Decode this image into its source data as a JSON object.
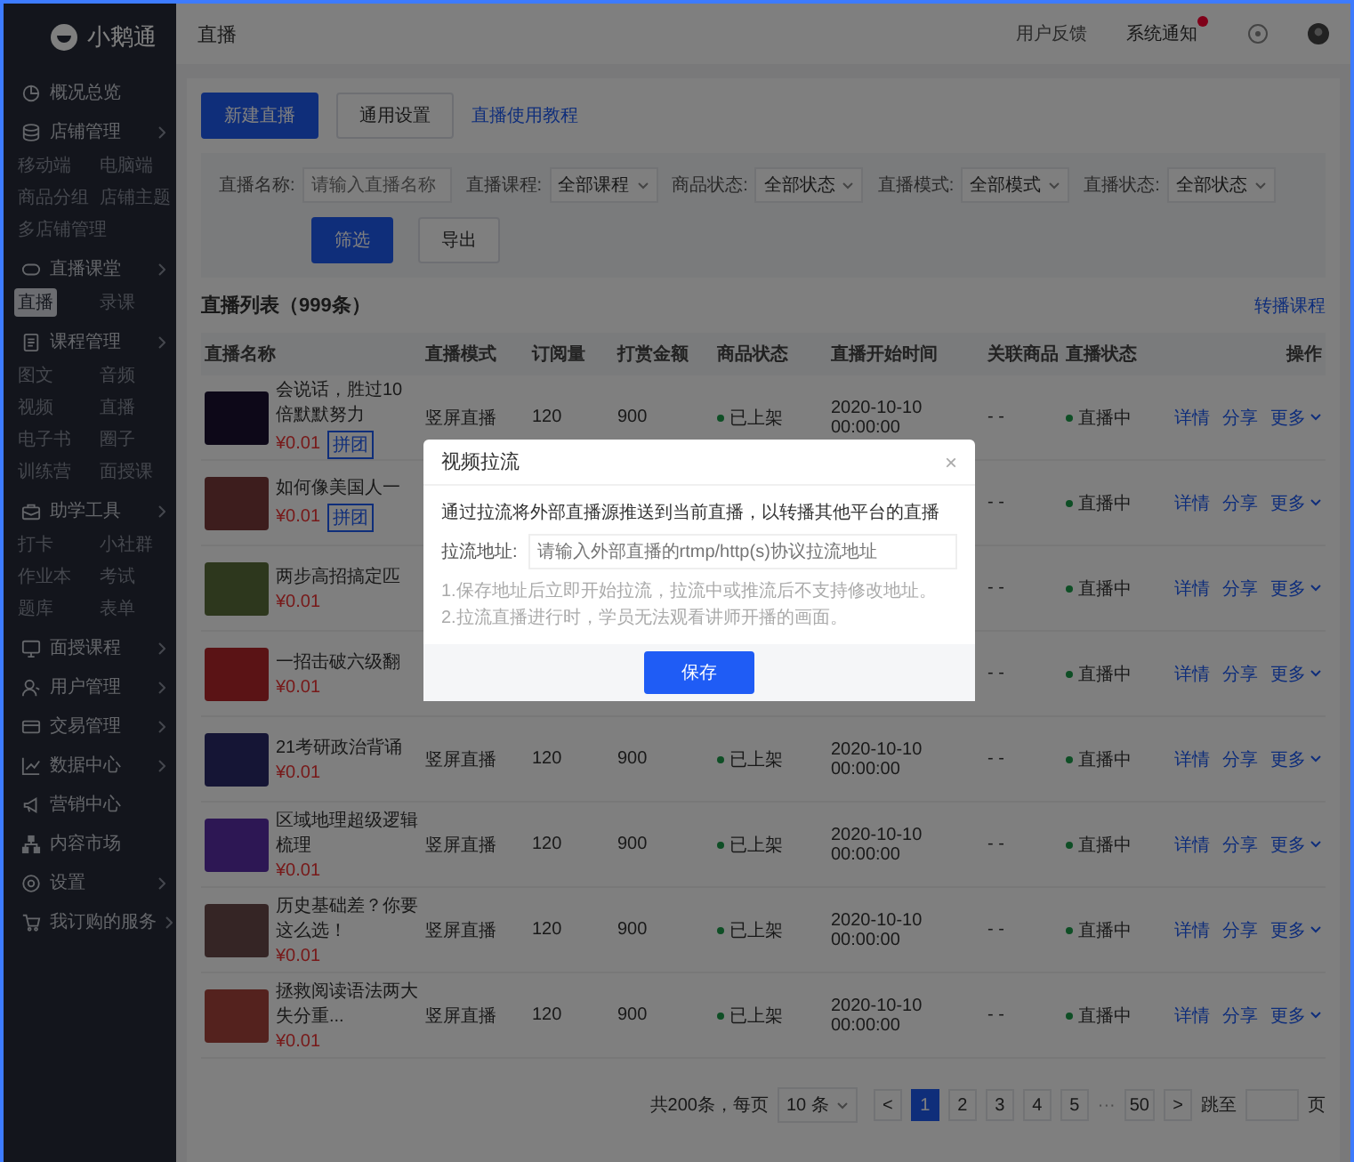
{
  "brand": {
    "name": "小鹅通"
  },
  "sidebar": {
    "items": [
      {
        "label": "概况总览",
        "chevron": false
      },
      {
        "label": "店铺管理",
        "chevron": true,
        "children": [
          {
            "label": "移动端",
            "selected": false
          },
          {
            "label": "电脑端",
            "selected": false
          },
          {
            "label": "商品分组",
            "selected": false
          },
          {
            "label": "店铺主题",
            "selected": false
          },
          {
            "label": "多店铺管理",
            "selected": false
          }
        ]
      },
      {
        "label": "直播课堂",
        "chevron": true,
        "children": [
          {
            "label": "直播",
            "selected": true
          },
          {
            "label": "录课",
            "selected": false
          }
        ]
      },
      {
        "label": "课程管理",
        "chevron": true,
        "children": [
          {
            "label": "图文",
            "selected": false
          },
          {
            "label": "音频",
            "selected": false
          },
          {
            "label": "视频",
            "selected": false
          },
          {
            "label": "直播",
            "selected": false
          },
          {
            "label": "电子书",
            "selected": false
          },
          {
            "label": "圈子",
            "selected": false
          },
          {
            "label": "训练营",
            "selected": false
          },
          {
            "label": "面授课",
            "selected": false
          }
        ]
      },
      {
        "label": "助学工具",
        "chevron": true,
        "children": [
          {
            "label": "打卡",
            "selected": false
          },
          {
            "label": "小社群",
            "selected": false
          },
          {
            "label": "作业本",
            "selected": false
          },
          {
            "label": "考试",
            "selected": false
          },
          {
            "label": "题库",
            "selected": false
          },
          {
            "label": "表单",
            "selected": false
          }
        ]
      },
      {
        "label": "面授课程",
        "chevron": true
      },
      {
        "label": "用户管理",
        "chevron": true
      },
      {
        "label": "交易管理",
        "chevron": true
      },
      {
        "label": "数据中心",
        "chevron": true
      },
      {
        "label": "营销中心",
        "chevron": false
      },
      {
        "label": "内容市场",
        "chevron": false
      },
      {
        "label": "设置",
        "chevron": true
      },
      {
        "label": "我订购的服务",
        "chevron": true
      }
    ]
  },
  "topbar": {
    "title": "直播",
    "feedback": "用户反馈",
    "notifications": {
      "label": "系统通知",
      "unread": true
    }
  },
  "toolbar": {
    "primary": "新建直播",
    "secondary": "通用设置",
    "link": "直播使用教程"
  },
  "filters": {
    "name": {
      "label": "直播名称:",
      "placeholder": "请输入直播名称"
    },
    "selects": [
      {
        "label": "直播课程:",
        "value": "全部课程"
      },
      {
        "label": "商品状态:",
        "value": "全部状态"
      },
      {
        "label": "直播模式:",
        "value": "全部模式"
      },
      {
        "label": "直播状态:",
        "value": "全部状态"
      }
    ],
    "apply": "筛选",
    "export": "导出"
  },
  "list": {
    "title": "直播列表（999条）",
    "link": "转播课程"
  },
  "table": {
    "columns": [
      "直播名称",
      "直播模式",
      "订阅量",
      "打赏金额",
      "商品状态",
      "直播开始时间",
      "关联商品",
      "直播状态",
      "操作"
    ],
    "rows": [
      {
        "title": "会说话，胜过10倍默默努力",
        "price": "¥0.01",
        "tag": "拼团",
        "mode": "竖屏直播",
        "subs": "120",
        "amount": "900",
        "product_status": "已上架",
        "start_time": [
          "2020-10-10",
          "00:00:00"
        ],
        "related": "- -",
        "live_status": "直播中",
        "actions": [
          "详情",
          "分享",
          "更多"
        ]
      },
      {
        "title": "如何像美国人一",
        "price": "¥0.01",
        "tag": "拼团",
        "related": "- -",
        "live_status": "直播中",
        "actions": [
          "详情",
          "分享",
          "更多"
        ]
      },
      {
        "title": "两步高招搞定匹",
        "price": "¥0.01",
        "related": "- -",
        "live_status": "直播中",
        "actions": [
          "详情",
          "分享",
          "更多"
        ]
      },
      {
        "title": "一招击破六级翻",
        "price": "¥0.01",
        "related": "- -",
        "live_status": "直播中",
        "actions": [
          "详情",
          "分享",
          "更多"
        ]
      },
      {
        "title": "21考研政治背诵",
        "price": "¥0.01",
        "mode": "竖屏直播",
        "subs": "120",
        "amount": "900",
        "product_status": "已上架",
        "start_time": [
          "2020-10-10",
          "00:00:00"
        ],
        "related": "- -",
        "live_status": "直播中",
        "actions": [
          "详情",
          "分享",
          "更多"
        ]
      },
      {
        "title": "区域地理超级逻辑梳理",
        "price": "¥0.01",
        "mode": "竖屏直播",
        "subs": "120",
        "amount": "900",
        "product_status": "已上架",
        "start_time": [
          "2020-10-10",
          "00:00:00"
        ],
        "related": "- -",
        "live_status": "直播中",
        "actions": [
          "详情",
          "分享",
          "更多"
        ]
      },
      {
        "title": "历史基础差？你要这么选！",
        "price": "¥0.01",
        "mode": "竖屏直播",
        "subs": "120",
        "amount": "900",
        "product_status": "已上架",
        "start_time": [
          "2020-10-10",
          "00:00:00"
        ],
        "related": "- -",
        "live_status": "直播中",
        "actions": [
          "详情",
          "分享",
          "更多"
        ]
      },
      {
        "title": "拯救阅读语法两大失分重...",
        "price": "¥0.01",
        "mode": "竖屏直播",
        "subs": "120",
        "amount": "900",
        "product_status": "已上架",
        "start_time": [
          "2020-10-10",
          "00:00:00"
        ],
        "related": "- -",
        "live_status": "直播中",
        "actions": [
          "详情",
          "分享",
          "更多"
        ]
      }
    ]
  },
  "pagination": {
    "total": "共200条，每页",
    "page_size": "10 条",
    "pages": [
      {
        "kind": "page",
        "label": "1",
        "selected": true
      },
      {
        "kind": "page",
        "label": "2",
        "selected": false
      },
      {
        "kind": "page",
        "label": "3",
        "selected": false
      },
      {
        "kind": "page",
        "label": "4",
        "selected": false
      },
      {
        "kind": "page",
        "label": "5",
        "selected": false
      },
      {
        "kind": "ellipsis",
        "label": "···"
      },
      {
        "kind": "page",
        "label": "50",
        "selected": false
      }
    ],
    "prev": "<",
    "next": ">",
    "jump": "跳至",
    "page_unit": "页"
  },
  "dialog": {
    "open": true,
    "title": "视频拉流",
    "close": "×",
    "description": "通过拉流将外部直播源推送到当前直播，以转播其他平台的直播",
    "field_label": "拉流地址:",
    "placeholder": "请输入外部直播的rtmp/http(s)协议拉流地址",
    "hints": [
      "1.保存地址后立即开始拉流，拉流中或推流后不支持修改地址。",
      "2.拉流直播进行时，学员无法观看讲师开播的画面。"
    ],
    "save": "保存"
  }
}
